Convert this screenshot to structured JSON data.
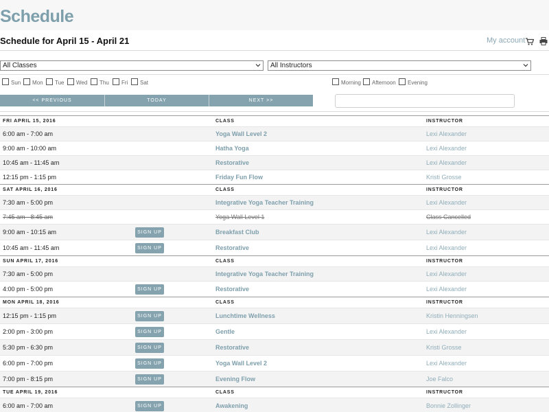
{
  "header": {
    "title": "Schedule",
    "subtitle": "Schedule for April 15 - April 21",
    "account_link": "My account"
  },
  "filters": {
    "classes_select": "All Classes",
    "instructors_select": "All Instructors",
    "days": [
      "Sun",
      "Mon",
      "Tue",
      "Wed",
      "Thu",
      "Fri",
      "Sat"
    ],
    "times": [
      "Morning",
      "Afternoon",
      "Evening"
    ]
  },
  "nav": {
    "previous": "<< PREVIOUS",
    "today": "TODAY",
    "next": "NEXT >>",
    "search_value": ""
  },
  "columns": {
    "class": "CLASS",
    "instructor": "INSTRUCTOR"
  },
  "signup_label": "SIGN UP",
  "days": [
    {
      "date": "FRI APRIL 15, 2016",
      "rows": [
        {
          "time": "6:00 am - 7:00 am",
          "class": "Yoga Wall Level 2",
          "instructor": "Lexi Alexander",
          "signup": false,
          "cancelled": false
        },
        {
          "time": "9:00 am - 10:00 am",
          "class": "Hatha Yoga",
          "instructor": "Lexi Alexander",
          "signup": false,
          "cancelled": false
        },
        {
          "time": "10:45 am - 11:45 am",
          "class": "Restorative",
          "instructor": "Lexi Alexander",
          "signup": false,
          "cancelled": false
        },
        {
          "time": "12:15 pm - 1:15 pm",
          "class": "Friday Fun Flow",
          "instructor": "Kristi Grosse",
          "signup": false,
          "cancelled": false
        }
      ]
    },
    {
      "date": "SAT APRIL 16, 2016",
      "rows": [
        {
          "time": "7:30 am - 5:00 pm",
          "class": "Integrative Yoga Teacher Training",
          "instructor": "Lexi Alexander",
          "signup": false,
          "cancelled": false
        },
        {
          "time": "7:45 am - 8:45 am",
          "class": "Yoga Wall Level 1",
          "instructor": "Class Cancelled",
          "signup": false,
          "cancelled": true
        },
        {
          "time": "9:00 am - 10:15 am",
          "class": "Breakfast Club",
          "instructor": "Lexi Alexander",
          "signup": true,
          "cancelled": false
        },
        {
          "time": "10:45 am - 11:45 am",
          "class": "Restorative",
          "instructor": "Lexi Alexander",
          "signup": true,
          "cancelled": false
        }
      ]
    },
    {
      "date": "SUN APRIL 17, 2016",
      "rows": [
        {
          "time": "7:30 am - 5:00 pm",
          "class": "Integrative Yoga Teacher Training",
          "instructor": "Lexi Alexander",
          "signup": false,
          "cancelled": false
        },
        {
          "time": "4:00 pm - 5:00 pm",
          "class": "Restorative",
          "instructor": "Lexi Alexander",
          "signup": true,
          "cancelled": false
        }
      ]
    },
    {
      "date": "MON APRIL 18, 2016",
      "rows": [
        {
          "time": "12:15 pm - 1:15 pm",
          "class": "Lunchtime Wellness",
          "instructor": "Kristin Henningsen",
          "signup": true,
          "cancelled": false
        },
        {
          "time": "2:00 pm - 3:00 pm",
          "class": "Gentle",
          "instructor": "Lexi Alexander",
          "signup": true,
          "cancelled": false
        },
        {
          "time": "5:30 pm - 6:30 pm",
          "class": "Restorative",
          "instructor": "Kristi Grosse",
          "signup": true,
          "cancelled": false
        },
        {
          "time": "6:00 pm - 7:00 pm",
          "class": "Yoga Wall Level 2",
          "instructor": "Lexi Alexander",
          "signup": true,
          "cancelled": false
        },
        {
          "time": "7:00 pm - 8:15 pm",
          "class": "Evening Flow",
          "instructor": "Joe Falco",
          "signup": true,
          "cancelled": false
        }
      ]
    },
    {
      "date": "TUE APRIL 19, 2016",
      "rows": [
        {
          "time": "6:00 am - 7:00 am",
          "class": "Awakening",
          "instructor": "Bonnie Zollinger",
          "signup": true,
          "cancelled": false
        }
      ]
    }
  ]
}
